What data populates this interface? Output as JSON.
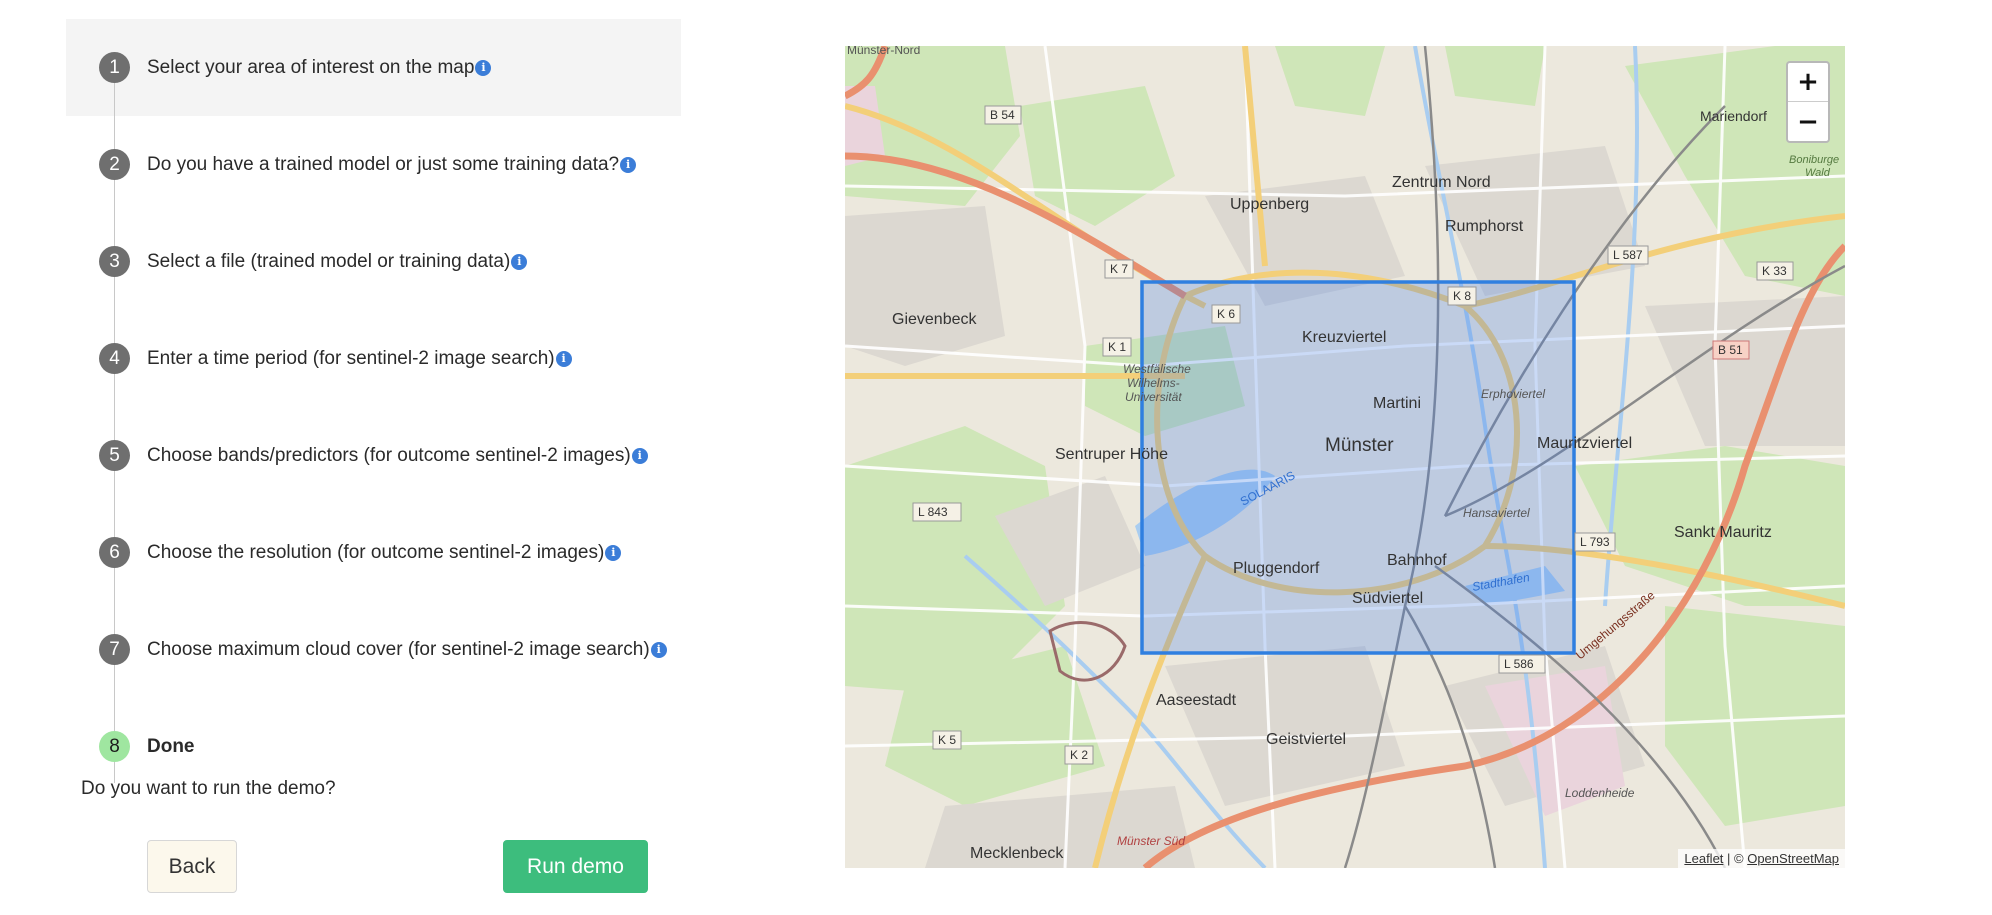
{
  "steps": [
    {
      "number": "1",
      "label": "Select your area of interest on the map",
      "info_icon": "info-icon",
      "active": true
    },
    {
      "number": "2",
      "label": "Do you have a trained model or just some training data?",
      "info_icon": "info-icon"
    },
    {
      "number": "3",
      "label": "Select a file (trained model or training data)",
      "info_icon": "info-icon"
    },
    {
      "number": "4",
      "label": "Enter a time period (for sentinel-2 image search)",
      "info_icon": "info-icon"
    },
    {
      "number": "5",
      "label": "Choose bands/predictors (for outcome sentinel-2 images)",
      "info_icon": "info-icon"
    },
    {
      "number": "6",
      "label": "Choose the resolution (for outcome sentinel-2 images)",
      "info_icon": "info-icon"
    },
    {
      "number": "7",
      "label": "Choose maximum cloud cover (for sentinel-2 image search)",
      "info_icon": "info-icon"
    },
    {
      "number": "8",
      "label": "Done",
      "status": "done"
    }
  ],
  "done_section": {
    "question": "Do you want to run the demo?",
    "back_label": "Back",
    "run_label": "Run demo"
  },
  "map": {
    "zoom_in": "+",
    "zoom_out": "−",
    "attribution_leaflet": "Leaflet",
    "attribution_sep": " | © ",
    "attribution_osm": "OpenStreetMap",
    "place_labels": {
      "muenster_nord": "Münster-Nord",
      "zentrum_nord": "Zentrum Nord",
      "mariendorf": "Mariendorf",
      "uppenberg": "Uppenberg",
      "rumphorst": "Rumphorst",
      "gievenbeck": "Gievenbeck",
      "kreuzviertel": "Kreuzviertel",
      "westf_uni_1": "Westfälische",
      "westf_uni_2": "Wilhelms-",
      "westf_uni_3": "Universität",
      "martini": "Martini",
      "muenster": "Münster",
      "erphoviertel": "Erphoviertel",
      "mauritzviertel": "Mauritzviertel",
      "sentruper_hoehe": "Sentruper Höhe",
      "solaaris": "SOLAARIS",
      "hansaviertel": "Hansaviertel",
      "sankt_mauritz": "Sankt Mauritz",
      "pluggendorf": "Pluggendorf",
      "bahnhof": "Bahnhof",
      "suedviertel": "Südviertel",
      "stadthafen": "Stadthafen",
      "aaseestadt": "Aaseestadt",
      "geistviertel": "Geistviertel",
      "loddenheide": "Loddenheide",
      "mecklenbeck": "Mecklenbeck",
      "muenster_sued": "Münster Süd",
      "umgehungsstrasse": "Umgehungsstraße",
      "boniburge_wald_1": "Boniburge",
      "boniburge_wald_2": "Wald"
    },
    "road_shields": {
      "b54": "B 54",
      "k7": "K 7",
      "k6": "K 6",
      "k8": "K 8",
      "k1": "K 1",
      "l587": "L 587",
      "k33": "K 33",
      "b51": "B 51",
      "l843": "L 843",
      "l793": "L 793",
      "l586": "L 586",
      "k5": "K 5",
      "k2": "K 2"
    },
    "colors": {
      "selection": "#2f7fe0",
      "motorway": "#e78b6e",
      "primary": "#f6d07a",
      "park": "#c8e3b4",
      "residential": "#dad7d1"
    }
  }
}
